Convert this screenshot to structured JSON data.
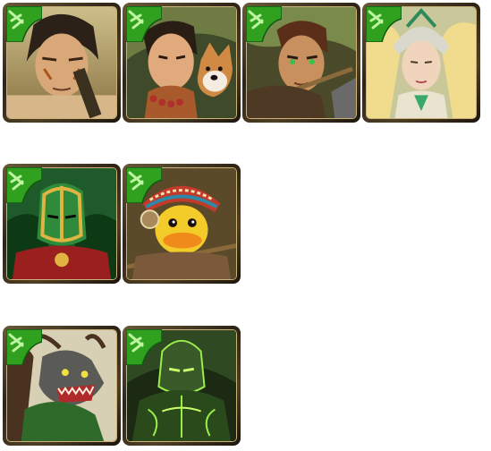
{
  "colors": {
    "badge_green": "#2fa11f",
    "badge_dark": "#0f5a10",
    "frame_gold": "#cdb27a",
    "frame_dark": "#2e2416"
  },
  "cards": [
    {
      "subject": "warrior-with-face-paint",
      "element": "wood",
      "icon": "leaf-badge-icon"
    },
    {
      "subject": "hunter-with-dog",
      "element": "wood",
      "icon": "leaf-badge-icon"
    },
    {
      "subject": "archer-with-green-eyes",
      "element": "wood",
      "icon": "leaf-badge-icon"
    },
    {
      "subject": "winged-helmet-maiden",
      "element": "wood",
      "icon": "leaf-badge-icon"
    },
    {
      "subject": "green-gold-armored-knight",
      "element": "wood",
      "icon": "leaf-badge-icon"
    },
    {
      "subject": "tribal-duck",
      "element": "wood",
      "icon": "leaf-badge-icon"
    },
    {
      "subject": "tree-dragon-beast",
      "element": "wood",
      "icon": "leaf-badge-icon"
    },
    {
      "subject": "glowing-green-golem",
      "element": "wood",
      "icon": "leaf-badge-icon"
    }
  ]
}
